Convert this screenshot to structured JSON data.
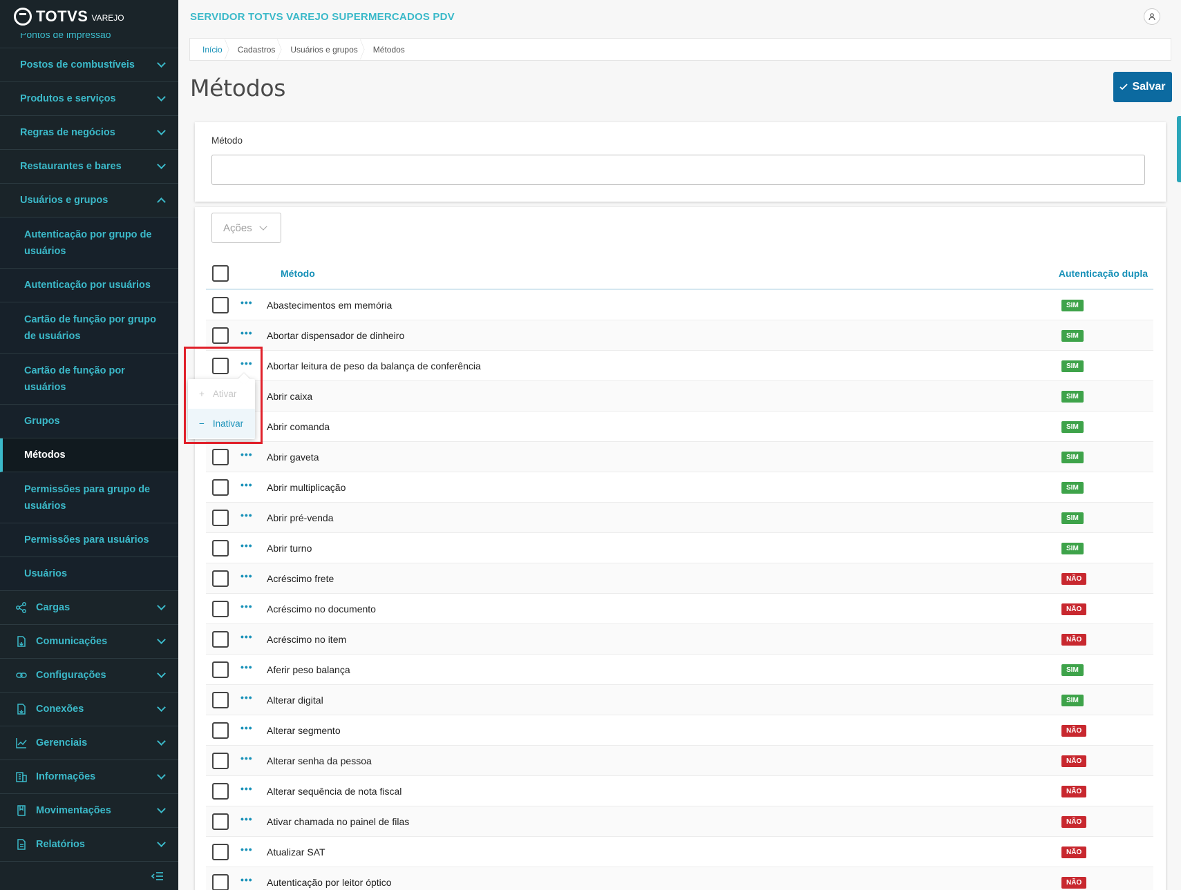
{
  "app": {
    "logo": "TOTVS",
    "logo_sub": "VAREJO",
    "server_title": "SERVIDOR TOTVS VAREJO SUPERMERCADOS PDV"
  },
  "sidebar": {
    "cut_item": "Pontos de impressão",
    "items_top": [
      {
        "label": "Postos de combustíveis"
      },
      {
        "label": "Produtos e serviços"
      },
      {
        "label": "Regras de negócios"
      },
      {
        "label": "Restaurantes e bares"
      },
      {
        "label": "Usuários e grupos"
      }
    ],
    "sub_items": [
      {
        "label": "Autenticação por grupo de usuários"
      },
      {
        "label": "Autenticação por usuários"
      },
      {
        "label": "Cartão de função por grupo de usuários"
      },
      {
        "label": "Cartão de função por usuários"
      },
      {
        "label": "Grupos"
      },
      {
        "label": "Métodos"
      },
      {
        "label": "Permissões para grupo de usuários"
      },
      {
        "label": "Permissões para usuários"
      },
      {
        "label": "Usuários"
      }
    ],
    "items_bottom": [
      {
        "label": "Cargas",
        "icon": "share-icon"
      },
      {
        "label": "Comunicações",
        "icon": "document-sync-icon"
      },
      {
        "label": "Configurações",
        "icon": "link-icon"
      },
      {
        "label": "Conexões",
        "icon": "document-sync-icon"
      },
      {
        "label": "Gerenciais",
        "icon": "chart-icon"
      },
      {
        "label": "Informações",
        "icon": "building-icon"
      },
      {
        "label": "Movimentações",
        "icon": "book-icon"
      },
      {
        "label": "Relatórios",
        "icon": "report-icon"
      }
    ]
  },
  "breadcrumb": [
    "Início",
    "Cadastros",
    "Usuários e grupos",
    "Métodos"
  ],
  "page": {
    "title": "Métodos",
    "save_label": "Salvar"
  },
  "filter": {
    "label": "Método",
    "value": ""
  },
  "actions_label": "Ações",
  "table": {
    "headers": {
      "name": "Método",
      "auth": "Autenticação dupla"
    },
    "rows": [
      {
        "name": "Abastecimentos em memória",
        "auth": "SIM"
      },
      {
        "name": "Abortar dispensador de dinheiro",
        "auth": "SIM"
      },
      {
        "name": "Abortar leitura de peso da balança de conferência",
        "auth": "SIM"
      },
      {
        "name": "Abrir caixa",
        "auth": "SIM"
      },
      {
        "name": "Abrir comanda",
        "auth": "SIM"
      },
      {
        "name": "Abrir gaveta",
        "auth": "SIM"
      },
      {
        "name": "Abrir multiplicação",
        "auth": "SIM"
      },
      {
        "name": "Abrir pré-venda",
        "auth": "SIM"
      },
      {
        "name": "Abrir turno",
        "auth": "SIM"
      },
      {
        "name": "Acréscimo frete",
        "auth": "NÃO"
      },
      {
        "name": "Acréscimo no documento",
        "auth": "NÃO"
      },
      {
        "name": "Acréscimo no item",
        "auth": "NÃO"
      },
      {
        "name": "Aferir peso balança",
        "auth": "SIM"
      },
      {
        "name": "Alterar digital",
        "auth": "SIM"
      },
      {
        "name": "Alterar segmento",
        "auth": "NÃO"
      },
      {
        "name": "Alterar senha da pessoa",
        "auth": "NÃO"
      },
      {
        "name": "Alterar sequência de nota fiscal",
        "auth": "NÃO"
      },
      {
        "name": "Ativar chamada no painel de filas",
        "auth": "NÃO"
      },
      {
        "name": "Atualizar SAT",
        "auth": "NÃO"
      },
      {
        "name": "Autenticação por leitor óptico",
        "auth": "NÃO"
      }
    ]
  },
  "popup": {
    "activate": "Ativar",
    "deactivate": "Inativar"
  },
  "colors": {
    "accent": "#3bb9c9",
    "primary": "#0c6aa0",
    "sim": "#3ea34a",
    "nao": "#c8282f",
    "highlight": "#e0202a"
  }
}
